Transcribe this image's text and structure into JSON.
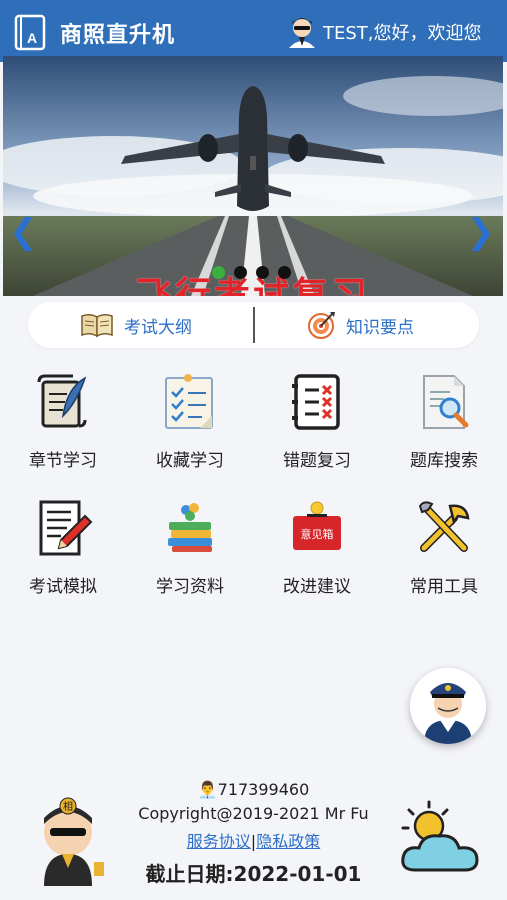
{
  "header": {
    "title": "商照直升机",
    "greeting": "TEST,您好，欢迎您",
    "logo_letter": "A"
  },
  "banner": {
    "caption": "飞行考试复习",
    "dots": 4,
    "active_dot": 0,
    "prev_icon": "chevron-left-icon",
    "next_icon": "chevron-right-icon"
  },
  "links": [
    {
      "label": "考试大纲",
      "icon": "open-book-icon"
    },
    {
      "label": "知识要点",
      "icon": "target-icon"
    }
  ],
  "grid": [
    {
      "label": "章节学习",
      "icon": "scroll-quill-icon"
    },
    {
      "label": "收藏学习",
      "icon": "checklist-icon"
    },
    {
      "label": "错题复习",
      "icon": "wrong-list-icon"
    },
    {
      "label": "题库搜索",
      "icon": "document-search-icon"
    },
    {
      "label": "考试模拟",
      "icon": "exam-pencil-icon"
    },
    {
      "label": "学习资料",
      "icon": "books-icon"
    },
    {
      "label": "改进建议",
      "icon": "suggestion-box-icon"
    },
    {
      "label": "常用工具",
      "icon": "tools-icon"
    }
  ],
  "suggestion_box_text": "意见箱",
  "footer": {
    "qq": "717399460",
    "copyright": "Copyright@2019-2021 Mr Fu",
    "service_link": "服务协议",
    "separator": "|",
    "privacy_link": "隐私政策",
    "deadline": "截止日期:2022-01-01",
    "mascot_badge": "相"
  },
  "colors": {
    "header_bg": "#2f6eb8",
    "link_blue": "#2c6fc7",
    "caption_red": "#e2232a",
    "active_dot": "#3bb041"
  }
}
